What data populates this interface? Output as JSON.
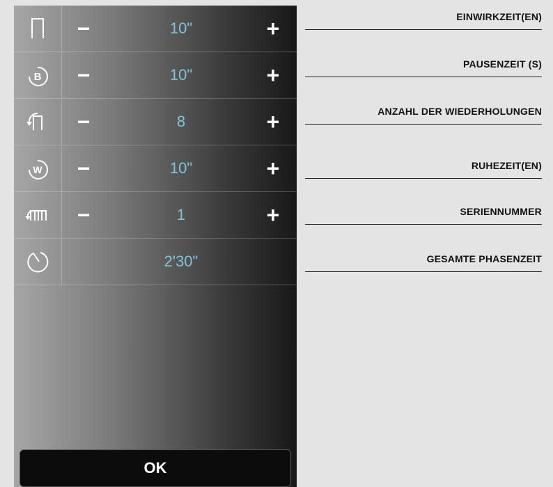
{
  "rows": [
    {
      "icon": "contraction-time-icon",
      "value": "10\"",
      "label": "EINWIRKZEIT(EN)"
    },
    {
      "icon": "pause-b-icon",
      "value": "10\"",
      "label": "PAUSENZEIT (S)"
    },
    {
      "icon": "repetitions-icon",
      "value": "8",
      "label": "ANZAHL DER WIEDERHOLUNGEN"
    },
    {
      "icon": "rest-w-icon",
      "value": "10\"",
      "label": "RUHEZEIT(EN)"
    },
    {
      "icon": "series-icon",
      "value": "1",
      "label": "SERIENNUMMER"
    }
  ],
  "total": {
    "icon": "timer-icon",
    "value": "2'30\"",
    "label": "GESAMTE PHASENZEIT"
  },
  "controls": {
    "minus": "−",
    "plus": "+",
    "ok": "OK"
  },
  "colors": {
    "value": "#7fc6d6",
    "background": "#e4e4e4"
  }
}
